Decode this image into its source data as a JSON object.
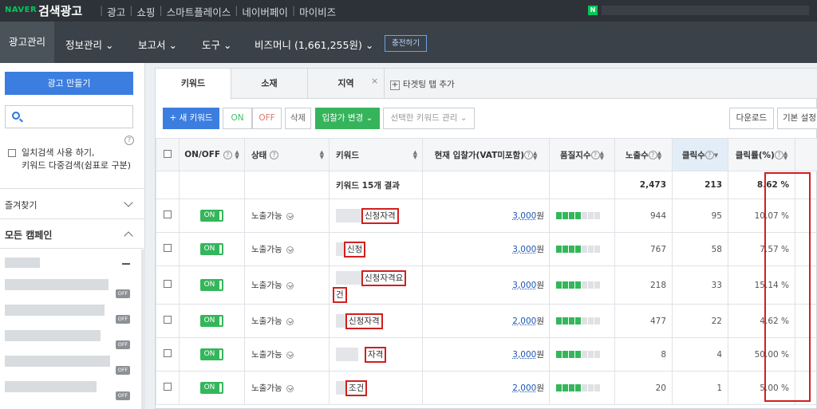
{
  "topbar": {
    "brand": "NAVER",
    "title": "검색광고",
    "links": [
      "광고",
      "쇼핑",
      "스마트플레이스",
      "네이버페이",
      "마이비즈"
    ],
    "service_badge": "N"
  },
  "navbar": {
    "items": [
      "광고관리",
      "정보관리",
      "보고서",
      "도구"
    ],
    "bizmoney": "비즈머니 (1,661,255원)",
    "charge_button": "충전하기"
  },
  "sidebar": {
    "create_button": "광고 만들기",
    "search_placeholder": "",
    "exact_line1": "일치검색 사용 하기,",
    "exact_line2": "키워드 다중검색(쉼표로 구분)",
    "favorites": "즐겨찾기",
    "all_campaigns": "모든 캠페인",
    "off_tag": "OFF",
    "help": "?"
  },
  "tabs": {
    "items": [
      "키워드",
      "소재",
      "지역"
    ],
    "close": "×",
    "add_tab": "타겟팅 탭 추가"
  },
  "toolbar": {
    "new_keyword": "+ 새 키워드",
    "on": "ON",
    "off": "OFF",
    "delete": "삭제",
    "bid_change": "입찰가 변경",
    "manage": "선택한 키워드 관리",
    "download": "다운로드",
    "settings": "기본 설정"
  },
  "table": {
    "headers": {
      "onoff": "ON/OFF",
      "status": "상태",
      "keyword": "키워드",
      "bid": "현재 입찰가(VAT미포함)",
      "quality": "품질지수",
      "impressions": "노출수",
      "clicks": "클릭수",
      "ctr": "클릭률(%)",
      "help": "?"
    },
    "summary": {
      "label": "키워드 15개 결과",
      "impressions": "2,473",
      "clicks": "213",
      "ctr": "8.62 %"
    },
    "on_label": "ON",
    "bid_unit": "원",
    "rows": [
      {
        "status": "노출가능",
        "keyword": "신청자격",
        "bid": "3,000",
        "quality_filled": 4,
        "impressions": "944",
        "clicks": "95",
        "ctr": "10.07 %"
      },
      {
        "status": "노출가능",
        "keyword": "신청",
        "bid": "3,000",
        "quality_filled": 4,
        "impressions": "767",
        "clicks": "58",
        "ctr": "7.57 %"
      },
      {
        "status": "노출가능",
        "keyword": "신청자격요",
        "keyword2": "건",
        "bid": "3,000",
        "quality_filled": 4,
        "impressions": "218",
        "clicks": "33",
        "ctr": "15.14 %"
      },
      {
        "status": "노출가능",
        "keyword": "신청자격",
        "bid": "2,000",
        "quality_filled": 4,
        "impressions": "477",
        "clicks": "22",
        "ctr": "4.62 %"
      },
      {
        "status": "노출가능",
        "keyword": "자격",
        "bid": "3,000",
        "quality_filled": 4,
        "impressions": "8",
        "clicks": "4",
        "ctr": "50.00 %"
      },
      {
        "status": "노출가능",
        "keyword": "조건",
        "bid": "2,000",
        "quality_filled": 4,
        "impressions": "20",
        "clicks": "1",
        "ctr": "5.00 %"
      }
    ]
  },
  "colors": {
    "accent": "#3c7ee0",
    "on_green": "#34b65a",
    "highlight_red": "#d11f1f"
  }
}
